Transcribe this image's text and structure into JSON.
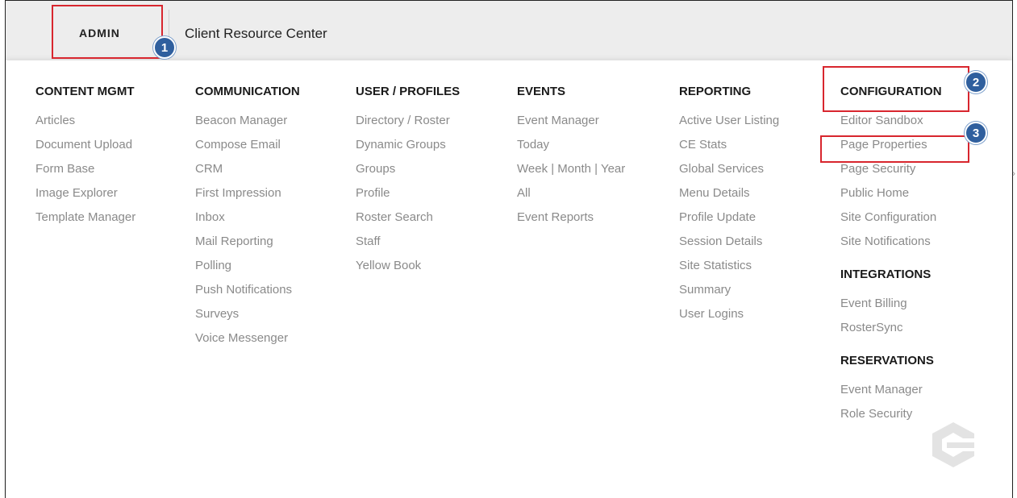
{
  "nav": {
    "admin_label": "ADMIN",
    "client_resource_center": "Client Resource Center"
  },
  "steps": [
    "1",
    "2",
    "3"
  ],
  "columns": [
    {
      "heading": "CONTENT MGMT",
      "items": [
        "Articles",
        "Document Upload",
        "Form Base",
        "Image Explorer",
        "Template Manager"
      ]
    },
    {
      "heading": "COMMUNICATION",
      "items": [
        "Beacon Manager",
        "Compose Email",
        "CRM",
        "First Impression",
        "Inbox",
        "Mail Reporting",
        "Polling",
        "Push Notifications",
        "Surveys",
        "Voice Messenger"
      ]
    },
    {
      "heading": "USER / PROFILES",
      "items": [
        "Directory / Roster",
        "Dynamic Groups",
        "Groups",
        "Profile",
        "Roster Search",
        "Staff",
        "Yellow Book"
      ]
    },
    {
      "heading": "EVENTS",
      "items": [
        "Event Manager",
        "Today",
        "Week | Month | Year",
        "All",
        "Event Reports"
      ]
    },
    {
      "heading": "REPORTING",
      "items": [
        "Active User Listing",
        "CE Stats",
        "Global Services",
        "Menu Details",
        "Profile Update",
        "Session Details",
        "Site Statistics",
        "Summary",
        "User Logins"
      ]
    }
  ],
  "configuration": {
    "heading": "CONFIGURATION",
    "items": [
      "Editor Sandbox",
      "Page Properties",
      "Page Security",
      "Public Home",
      "Site Configuration",
      "Site Notifications"
    ]
  },
  "integrations": {
    "heading": "INTEGRATIONS",
    "items": [
      "Event Billing",
      "RosterSync"
    ]
  },
  "reservations": {
    "heading": "RESERVATIONS",
    "items": [
      "Event Manager",
      "Role Security"
    ]
  },
  "colors": {
    "highlight": "#d8262e",
    "badge": "#2f5f9e",
    "item_text": "#8a8a8a",
    "heading_text": "#1a1a1a"
  }
}
